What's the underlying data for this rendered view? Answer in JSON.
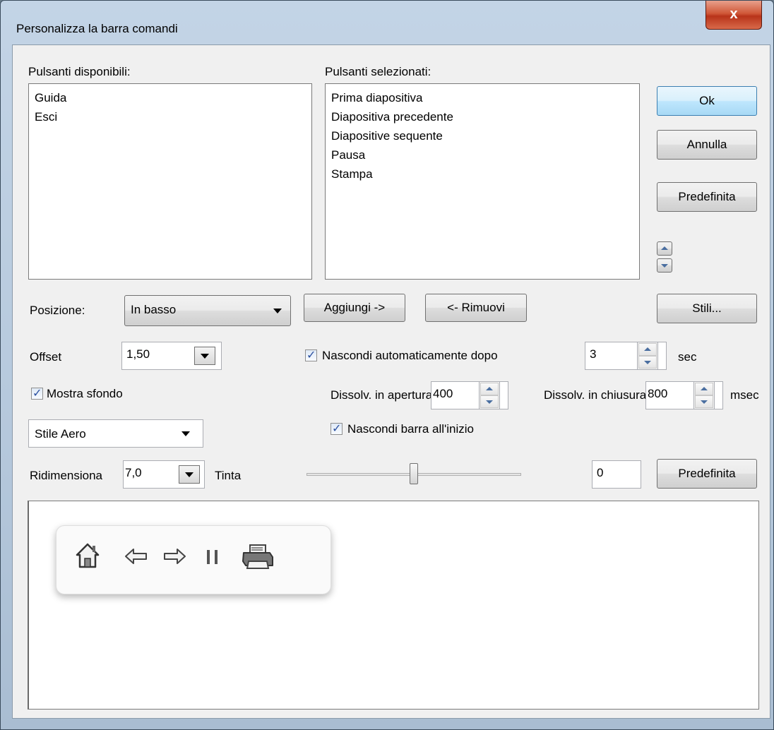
{
  "window": {
    "title": "Personalizza la barra comandi",
    "close_glyph": "x"
  },
  "available": {
    "label": "Pulsanti disponibili:",
    "items": [
      "Guida",
      "Esci"
    ]
  },
  "selected": {
    "label": "Pulsanti selezionati:",
    "items": [
      "Prima diapositiva",
      "Diapositiva precedente",
      "Diapositive sequente",
      "Pausa",
      "Stampa"
    ]
  },
  "buttons": {
    "ok": "Ok",
    "cancel": "Annulla",
    "default_top": "Predefinita",
    "add": "Aggiungi ->",
    "remove": "<- Rimuovi",
    "styles": "Stili...",
    "default_bottom": "Predefinita"
  },
  "position": {
    "label": "Posizione:",
    "value": "In basso"
  },
  "offset": {
    "label": "Offset",
    "value": "1,50"
  },
  "autohide": {
    "label": "Nascondi automaticamente dopo",
    "checked": true,
    "value": "3",
    "unit": "sec"
  },
  "fade_in": {
    "label": "Dissolv. in apertura",
    "value": "400"
  },
  "fade_out": {
    "label": "Dissolv. in chiusura",
    "value": "800",
    "unit": "msec"
  },
  "show_background": {
    "label": "Mostra sfondo",
    "checked": true
  },
  "hide_at_start": {
    "label": "Nascondi barra all'inizio",
    "checked": true
  },
  "style": {
    "value": "Stile Aero"
  },
  "resize": {
    "label": "Ridimensiona",
    "value": "7,0"
  },
  "tint": {
    "label": "Tinta",
    "slider_fraction": 0.5,
    "value": "0"
  },
  "preview_icons": [
    "home-icon",
    "arrow-left-icon",
    "arrow-right-icon",
    "pause-icon",
    "printer-icon"
  ]
}
